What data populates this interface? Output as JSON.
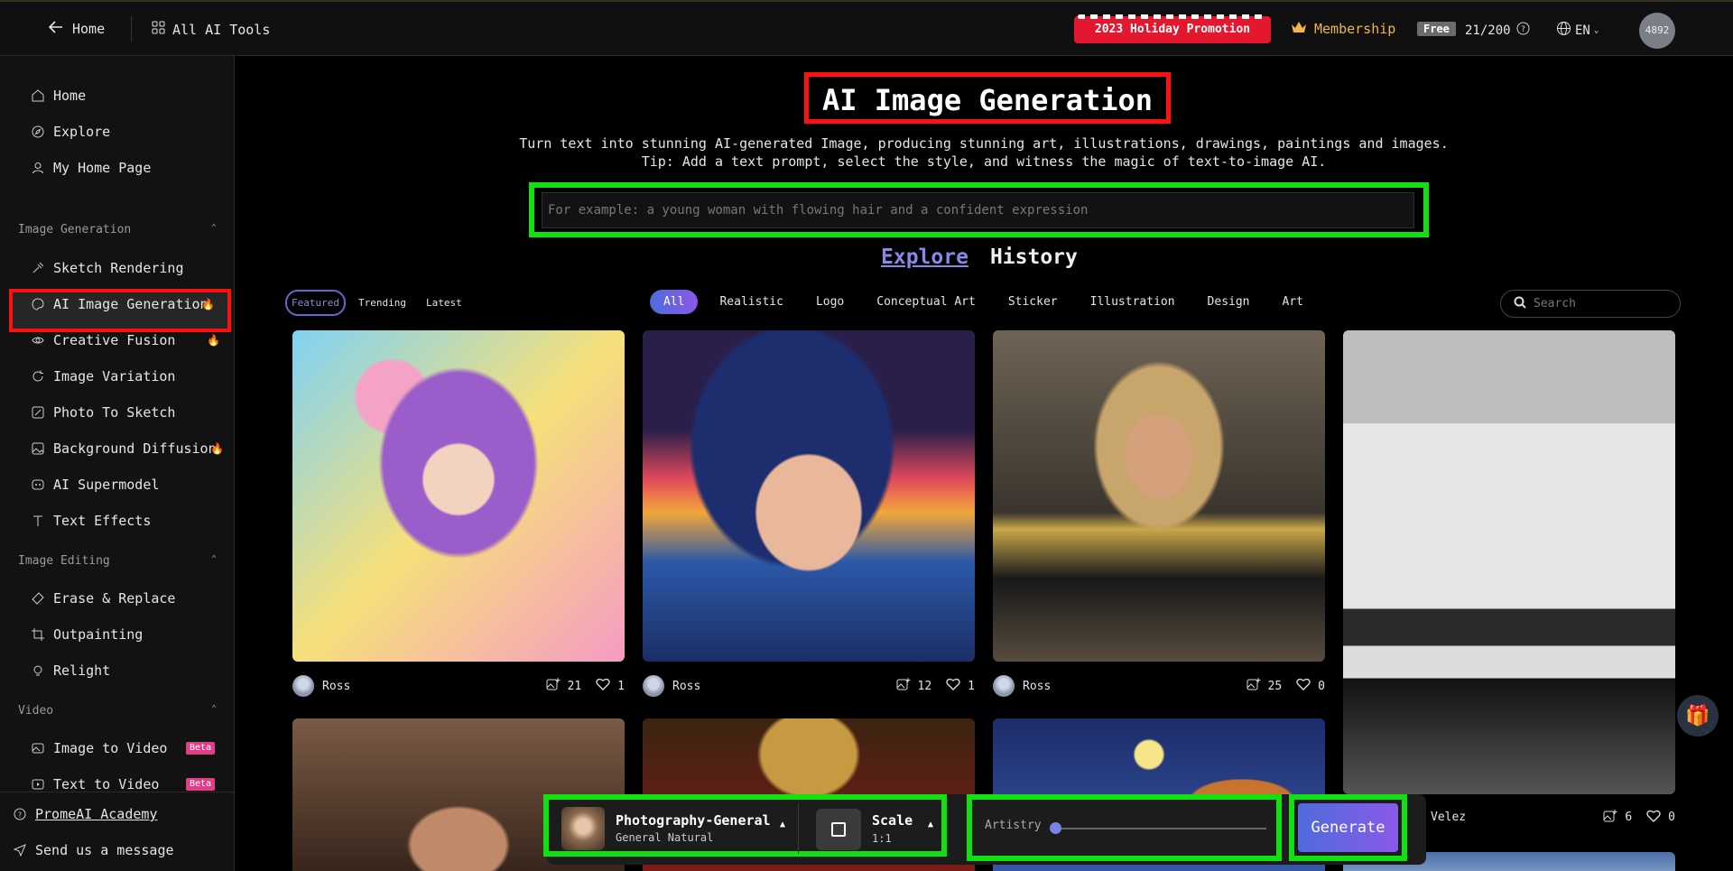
{
  "topbar": {
    "home": "Home",
    "all_tools": "All AI Tools",
    "promo": "2023 Holiday Promotion",
    "membership": "Membership",
    "plan": "Free",
    "quota": "21/200",
    "language": "EN",
    "avatar": "4892"
  },
  "sidebar": {
    "top_items": [
      "Home",
      "Explore",
      "My Home Page"
    ],
    "sections": [
      {
        "title": "Image Generation",
        "items": [
          "Sketch Rendering",
          "AI Image Generation",
          "Creative Fusion",
          "Image Variation",
          "Photo To Sketch",
          "Background Diffusion",
          "AI Supermodel",
          "Text Effects"
        ]
      },
      {
        "title": "Image Editing",
        "items": [
          "Erase & Replace",
          "Outpainting",
          "Relight"
        ]
      },
      {
        "title": "Video",
        "items": [
          "Image to Video",
          "Text to Video"
        ]
      }
    ],
    "beta": "Beta",
    "academy": "PromeAI Academy",
    "message": "Send us a message"
  },
  "main": {
    "title": "AI Image Generation",
    "subtitle1": "Turn text into stunning AI-generated Image, producing stunning art, illustrations, drawings, paintings and images.",
    "subtitle2": "Tip: Add a text prompt, select the style, and witness the magic of text-to-image AI.",
    "prompt_placeholder": "For example: a young woman with flowing hair and a confident expression",
    "tabs": [
      "Explore",
      "History"
    ],
    "sort": [
      "Featured",
      "Trending",
      "Latest"
    ],
    "categories": [
      "All",
      "Realistic",
      "Logo",
      "Conceptual Art",
      "Sticker",
      "Illustration",
      "Design",
      "Art"
    ],
    "search_placeholder": "Search"
  },
  "cards": [
    {
      "author": "Ross",
      "uses": "21",
      "likes": "1"
    },
    {
      "author": "Ross",
      "uses": "12",
      "likes": "1"
    },
    {
      "author": "Ross",
      "uses": "25",
      "likes": "0"
    },
    {
      "author": "Velez",
      "uses": "6",
      "likes": "0"
    }
  ],
  "controls": {
    "style_name": "Photography-General",
    "style_sub": "General Natural",
    "scale_label": "Scale",
    "scale_value": "1:1",
    "artistry_label": "Artistry",
    "artistry_value": 0,
    "generate": "Generate"
  }
}
